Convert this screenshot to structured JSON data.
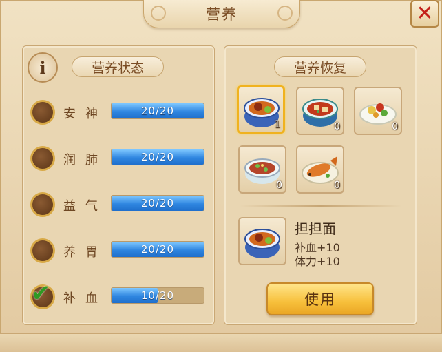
{
  "window": {
    "title": "营养",
    "close_icon": "close-x-icon"
  },
  "status_panel": {
    "heading": "营养状态",
    "info_icon": "i",
    "stats": [
      {
        "name": "安神",
        "value": 20,
        "max": 20,
        "text": "20/20",
        "checked": false
      },
      {
        "name": "润肺",
        "value": 20,
        "max": 20,
        "text": "20/20",
        "checked": false
      },
      {
        "name": "益气",
        "value": 20,
        "max": 20,
        "text": "20/20",
        "checked": false
      },
      {
        "name": "养胃",
        "value": 20,
        "max": 20,
        "text": "20/20",
        "checked": false
      },
      {
        "name": "补血",
        "value": 10,
        "max": 20,
        "text": "10/20",
        "checked": true
      }
    ]
  },
  "recovery_panel": {
    "heading": "营养恢复",
    "foods": [
      {
        "icon": "dandan-noodle-bowl-icon",
        "qty": "1",
        "selected": true
      },
      {
        "icon": "mapo-tofu-bowl-icon",
        "qty": "0",
        "selected": false
      },
      {
        "icon": "stir-fry-plate-icon",
        "qty": "0",
        "selected": false
      },
      {
        "icon": "diced-meat-bowl-icon",
        "qty": "0",
        "selected": false
      },
      {
        "icon": "steamed-fish-plate-icon",
        "qty": "0",
        "selected": false
      }
    ],
    "selected_item": {
      "name": "担担面",
      "effects": [
        "补血+10",
        "体力+10"
      ]
    },
    "use_button": "使用"
  },
  "colors": {
    "bar_fill": "#2f86e0",
    "use_button": "#f7c03b",
    "close": "#c4201a"
  }
}
